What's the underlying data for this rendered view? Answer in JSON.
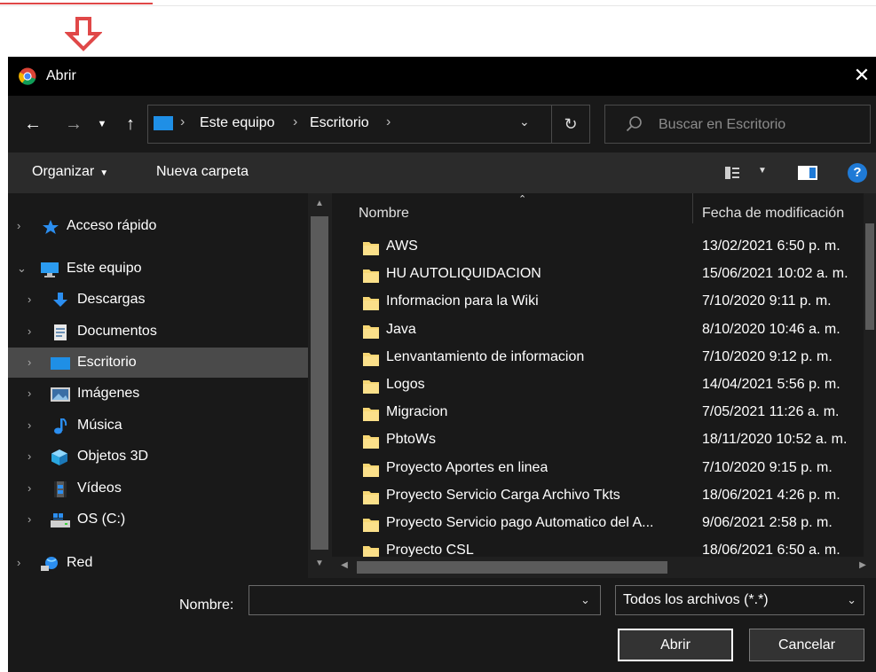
{
  "window": {
    "title": "Abrir",
    "close_glyph": "✕"
  },
  "address": {
    "crumbs": [
      "Este equipo",
      "Escritorio"
    ],
    "search_placeholder": "Buscar en Escritorio"
  },
  "toolbar": {
    "organize": "Organizar",
    "new_folder": "Nueva carpeta",
    "help": "?"
  },
  "sidebar": {
    "items": [
      {
        "label": "Acceso rápido",
        "icon": "star-icon"
      },
      {
        "label": "Este equipo",
        "icon": "computer-icon"
      },
      {
        "label": "Descargas",
        "icon": "download-icon"
      },
      {
        "label": "Documentos",
        "icon": "documents-icon"
      },
      {
        "label": "Escritorio",
        "icon": "desktop-icon",
        "selected": true
      },
      {
        "label": "Imágenes",
        "icon": "pictures-icon"
      },
      {
        "label": "Música",
        "icon": "music-icon"
      },
      {
        "label": "Objetos 3D",
        "icon": "3d-objects-icon"
      },
      {
        "label": "Vídeos",
        "icon": "videos-icon"
      },
      {
        "label": "OS (C:)",
        "icon": "drive-icon"
      },
      {
        "label": "Red",
        "icon": "network-icon"
      }
    ]
  },
  "files": {
    "columns": {
      "name": "Nombre",
      "date": "Fecha de modificación"
    },
    "rows": [
      {
        "name": "AWS",
        "date": "13/02/2021 6:50 p. m."
      },
      {
        "name": "HU AUTOLIQUIDACION",
        "date": "15/06/2021 10:02 a. m."
      },
      {
        "name": "Informacion para la Wiki",
        "date": "7/10/2020 9:11 p. m."
      },
      {
        "name": "Java",
        "date": "8/10/2020 10:46 a. m."
      },
      {
        "name": "Lenvantamiento de informacion",
        "date": "7/10/2020 9:12 p. m."
      },
      {
        "name": "Logos",
        "date": "14/04/2021 5:56 p. m."
      },
      {
        "name": "Migracion",
        "date": "7/05/2021 11:26 a. m."
      },
      {
        "name": "PbtoWs",
        "date": "18/11/2020 10:52 a. m."
      },
      {
        "name": "Proyecto Aportes en linea",
        "date": "7/10/2020 9:15 p. m."
      },
      {
        "name": "Proyecto Servicio Carga Archivo Tkts",
        "date": "18/06/2021 4:26 p. m."
      },
      {
        "name": "Proyecto Servicio pago Automatico del A...",
        "date": "9/06/2021 2:58 p. m."
      },
      {
        "name": "Proyecto CSL",
        "date": "18/06/2021 6:50 a. m."
      }
    ]
  },
  "bottom": {
    "name_label": "Nombre:",
    "name_value": "",
    "filter": "Todos los archivos (*.*)",
    "open": "Abrir",
    "cancel": "Cancelar"
  },
  "colors": {
    "background": "#191919",
    "titlebar": "#000000",
    "toolbar": "#2b2b2b",
    "selected": "#4a4a4a",
    "accent": "#1f7ad6",
    "folder": "#f7d774",
    "arrow": "#e04848"
  }
}
